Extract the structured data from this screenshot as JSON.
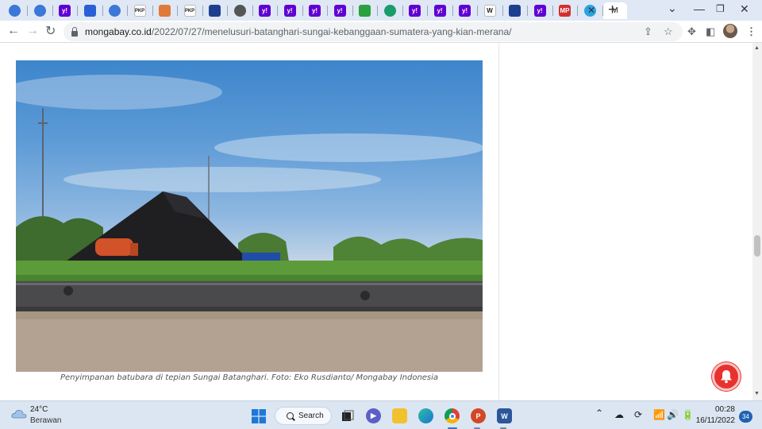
{
  "browser": {
    "tabs": [
      {
        "icon": "chrome-c-icon",
        "color": "#3b78d8"
      },
      {
        "icon": "chrome-c-icon",
        "color": "#3b78d8"
      },
      {
        "icon": "yahoo-icon",
        "color": "#6001d2"
      },
      {
        "icon": "diamond-icon",
        "color": "#2b5fd6"
      },
      {
        "icon": "chrome-c-icon",
        "color": "#3b78d8"
      },
      {
        "icon": "pkp-icon",
        "color": "#ffffff"
      },
      {
        "icon": "orange-square-icon",
        "color": "#e07a3a"
      },
      {
        "icon": "pkp-icon",
        "color": "#ffffff"
      },
      {
        "icon": "blue-grid-icon",
        "color": "#1d3f8f"
      },
      {
        "icon": "globe-icon",
        "color": "#555555"
      },
      {
        "icon": "yahoo-icon",
        "color": "#6001d2"
      },
      {
        "icon": "yahoo-icon",
        "color": "#6001d2"
      },
      {
        "icon": "yahoo-icon",
        "color": "#6001d2"
      },
      {
        "icon": "yahoo-icon",
        "color": "#6001d2"
      },
      {
        "icon": "squares-icon",
        "color": "#2aa03f"
      },
      {
        "icon": "s-circle-icon",
        "color": "#1a9c6c"
      },
      {
        "icon": "yahoo-icon",
        "color": "#6001d2"
      },
      {
        "icon": "yahoo-icon",
        "color": "#6001d2"
      },
      {
        "icon": "yahoo-icon",
        "color": "#6001d2"
      },
      {
        "icon": "wikipedia-icon",
        "color": "#ffffff"
      },
      {
        "icon": "flag-icon",
        "color": "#1d3f8f"
      },
      {
        "icon": "yahoo-icon",
        "color": "#6001d2"
      },
      {
        "icon": "mp-icon",
        "color": "#d32f2f"
      },
      {
        "icon": "telegram-icon",
        "color": "#2aa3e0"
      },
      {
        "icon": "mongabay-icon",
        "color": "#ffffff",
        "label": "M"
      }
    ],
    "pkp_label": "PKP",
    "wiki_label": "W",
    "yahoo_label": "y!",
    "mp_label": "MP",
    "url_host": "mongabay.co.id",
    "url_path": "/2022/07/27/menelusuri-batanghari-sungai-kebanggaan-sumatera-yang-kian-merana/"
  },
  "article": {
    "photo_alt": "Coal stockpile on the bank of the Batanghari River",
    "caption": "Penyimpanan batubara di tepian Sungai Batanghari. Foto: Eko Rusdianto/ Mongabay Indonesia"
  },
  "taskbar": {
    "temperature": "24°C",
    "weather": "Berawan",
    "search_label": "Search",
    "time": "00:28",
    "date": "16/11/2022",
    "notification_count": "34"
  },
  "colors": {
    "tabstrip": "#dfe8f4",
    "notification_bell": "#e8322e",
    "taskbar": "#dce6f2"
  }
}
